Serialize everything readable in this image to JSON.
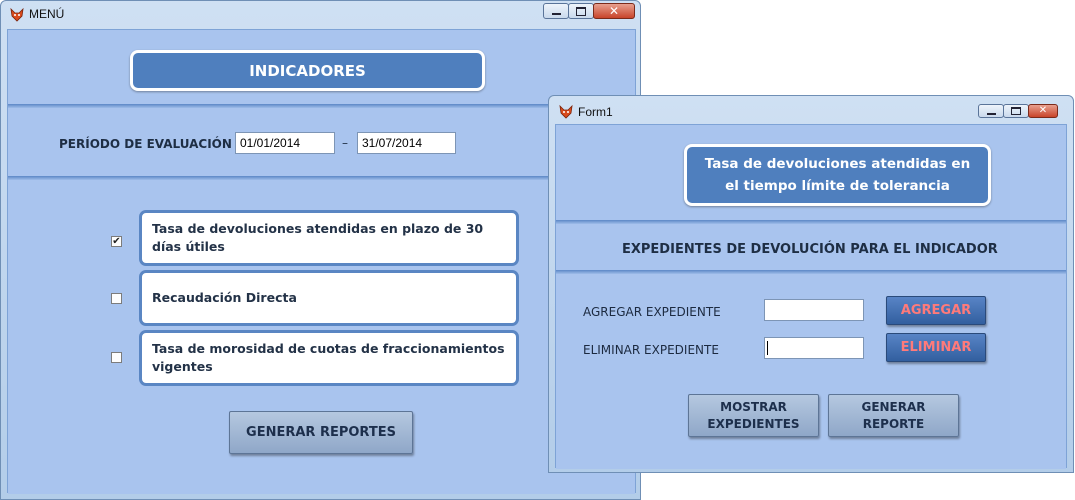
{
  "menu_window": {
    "title": "MENÚ",
    "header": "INDICADORES",
    "period_label": "PERÍODO DE EVALUACIÓN",
    "date_from": "01/01/2014",
    "date_separator": "–",
    "date_to": "31/07/2014",
    "indicators": [
      {
        "label": "Tasa de devoluciones atendidas en plazo de 30 días útiles",
        "checked": true,
        "check_glyph": "✔"
      },
      {
        "label": "Recaudación Directa",
        "checked": false,
        "check_glyph": ""
      },
      {
        "label": "Tasa de morosidad de cuotas de fraccionamientos vigentes",
        "checked": false,
        "check_glyph": ""
      }
    ],
    "generate_button": "GENERAR REPORTES"
  },
  "form_window": {
    "title": "Form1",
    "header": "Tasa de devoluciones atendidas en el tiempo límite de tolerancia",
    "section_title": "EXPEDIENTES DE DEVOLUCIÓN PARA EL INDICADOR",
    "add_label": "AGREGAR EXPEDIENTE",
    "add_value": "",
    "add_button": "AGREGAR",
    "remove_label": "ELIMINAR EXPEDIENTE",
    "remove_value": "",
    "remove_button": "ELIMINAR",
    "show_button": "MOSTRAR EXPEDIENTES",
    "report_button": "GENERAR REPORTE"
  },
  "icons": {
    "app_icon": "fox-icon",
    "minimize": "minimize-icon",
    "maximize": "maximize-icon",
    "close": "close-icon"
  },
  "colors": {
    "client_background": "#a9c4ee",
    "header_panel": "#4f7fbe",
    "danger_text": "#ff7a7a"
  }
}
